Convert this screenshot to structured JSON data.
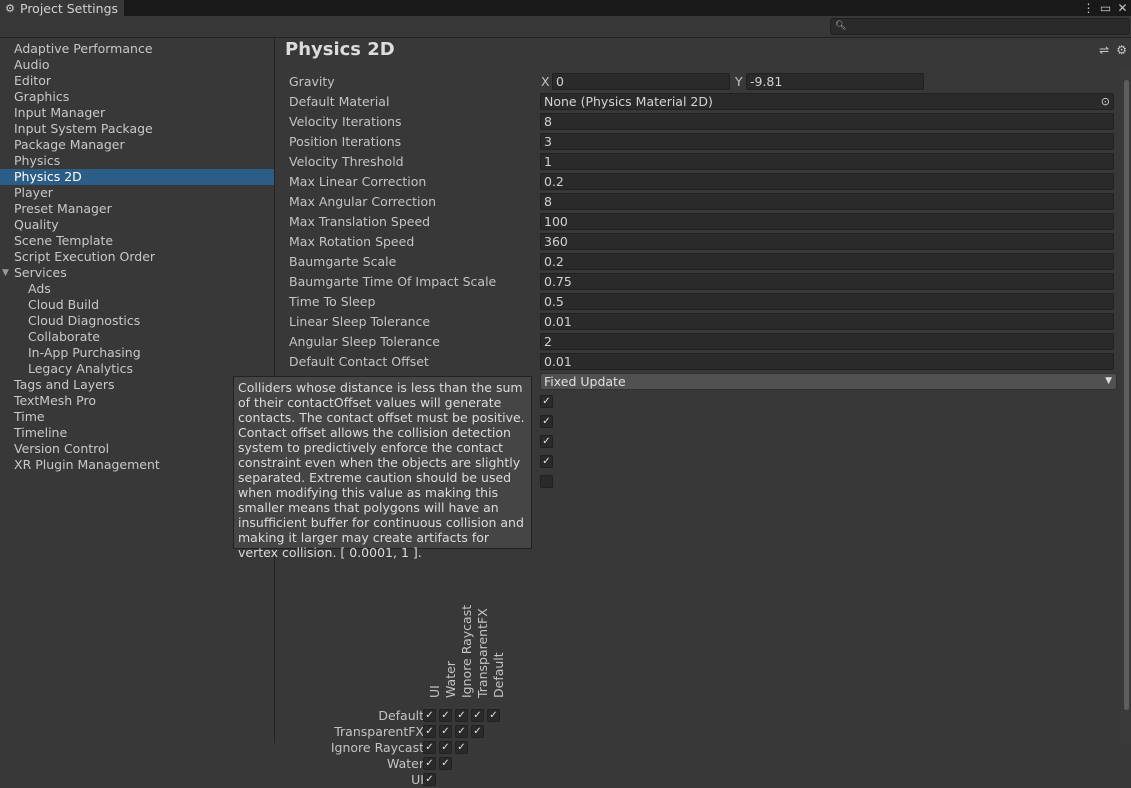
{
  "window": {
    "title": "Project Settings",
    "tab_icon": "gear-icon",
    "buttons": {
      "menu": "⋮",
      "maximize": "▭",
      "close": "✕"
    }
  },
  "search": {
    "placeholder": "",
    "icon": "search-icon"
  },
  "sidebar": {
    "items": [
      {
        "label": "Adaptive Performance"
      },
      {
        "label": "Audio"
      },
      {
        "label": "Editor"
      },
      {
        "label": "Graphics"
      },
      {
        "label": "Input Manager"
      },
      {
        "label": "Input System Package"
      },
      {
        "label": "Package Manager"
      },
      {
        "label": "Physics"
      },
      {
        "label": "Physics 2D",
        "selected": true
      },
      {
        "label": "Player"
      },
      {
        "label": "Preset Manager"
      },
      {
        "label": "Quality"
      },
      {
        "label": "Scene Template"
      },
      {
        "label": "Script Execution Order"
      },
      {
        "label": "Services",
        "expanded": true
      },
      {
        "label": "Ads",
        "child": true
      },
      {
        "label": "Cloud Build",
        "child": true
      },
      {
        "label": "Cloud Diagnostics",
        "child": true
      },
      {
        "label": "Collaborate",
        "child": true
      },
      {
        "label": "In-App Purchasing",
        "child": true
      },
      {
        "label": "Legacy Analytics",
        "child": true
      },
      {
        "label": "Tags and Layers"
      },
      {
        "label": "TextMesh Pro"
      },
      {
        "label": "Time"
      },
      {
        "label": "Timeline"
      },
      {
        "label": "Version Control"
      },
      {
        "label": "XR Plugin Management"
      }
    ]
  },
  "panel": {
    "title": "Physics 2D",
    "gravity": {
      "label": "Gravity",
      "x_label": "X",
      "x": "0",
      "y_label": "Y",
      "y": "-9.81"
    },
    "default_material": {
      "label": "Default Material",
      "value": "None (Physics Material 2D)"
    },
    "fields": [
      {
        "label": "Velocity Iterations",
        "value": "8"
      },
      {
        "label": "Position Iterations",
        "value": "3"
      },
      {
        "label": "Velocity Threshold",
        "value": "1"
      },
      {
        "label": "Max Linear Correction",
        "value": "0.2"
      },
      {
        "label": "Max Angular Correction",
        "value": "8"
      },
      {
        "label": "Max Translation Speed",
        "value": "100"
      },
      {
        "label": "Max Rotation Speed",
        "value": "360"
      },
      {
        "label": "Baumgarte Scale",
        "value": "0.2"
      },
      {
        "label": "Baumgarte Time Of Impact Scale",
        "value": "0.75"
      },
      {
        "label": "Time To Sleep",
        "value": "0.5"
      },
      {
        "label": "Linear Sleep Tolerance",
        "value": "0.01"
      },
      {
        "label": "Angular Sleep Tolerance",
        "value": "2"
      },
      {
        "label": "Default Contact Offset",
        "value": "0.01"
      }
    ],
    "simulation_mode": {
      "value": "Fixed Update"
    },
    "checkboxes": [
      {
        "checked": true
      },
      {
        "checked": true
      },
      {
        "checked": true
      },
      {
        "checked": true
      },
      {
        "checked": false
      }
    ],
    "tooltip": "Colliders whose distance is less than the sum of their contactOffset values will generate contacts. The contact offset must be positive. Contact offset allows the collision detection system to predictively enforce the contact constraint even when the objects are slightly separated. Extreme caution should be used when modifying this value as making this smaller means that polygons will have an insufficient buffer for continuous collision and making it larger may create artifacts for vertex collision. [ 0.0001, 1  ].",
    "matrix": {
      "columns": [
        "UI",
        "Water",
        "Ignore Raycast",
        "TransparentFX",
        "Default"
      ],
      "rows": [
        {
          "label": "Default",
          "checks": 5
        },
        {
          "label": "TransparentFX",
          "checks": 4
        },
        {
          "label": "Ignore Raycast",
          "checks": 3
        },
        {
          "label": "Water",
          "checks": 2
        },
        {
          "label": "UI",
          "checks": 1
        }
      ],
      "check_glyph": "✓"
    }
  }
}
